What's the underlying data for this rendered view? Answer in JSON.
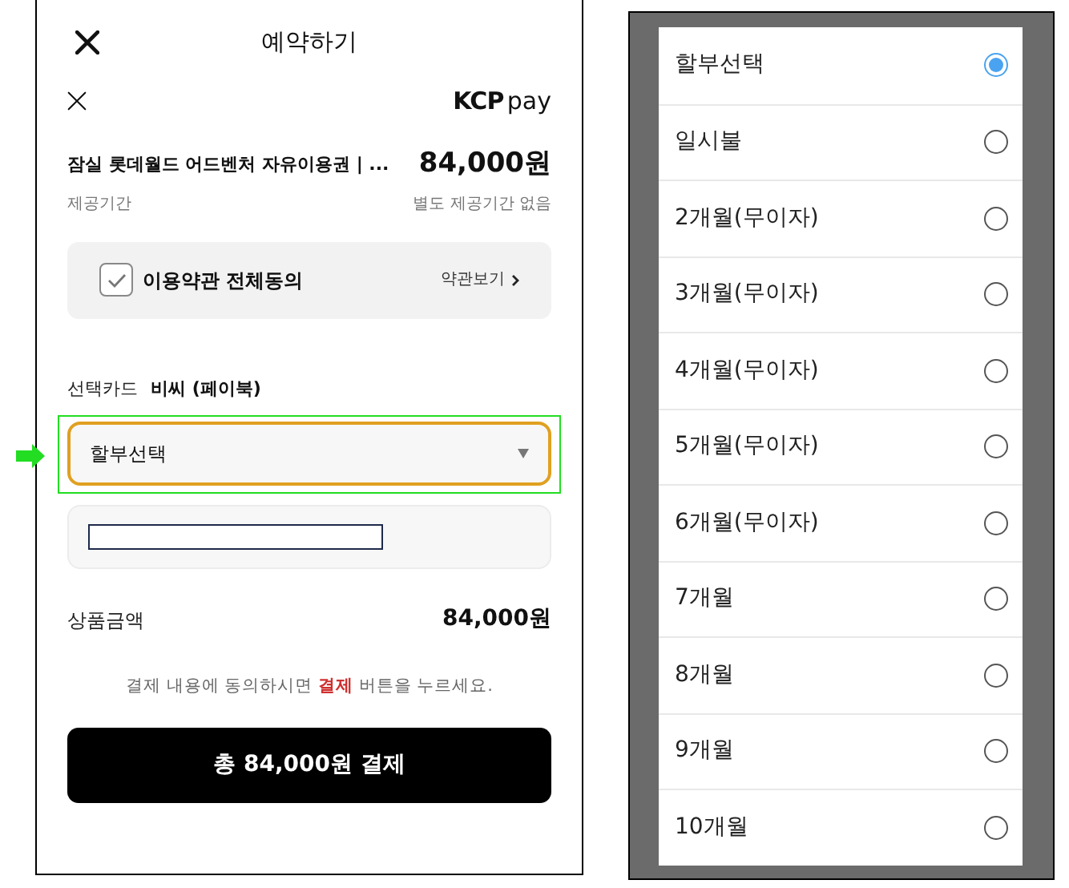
{
  "payment_screen": {
    "title": "예약하기",
    "brand": {
      "first": "KCP",
      "second": "pay"
    },
    "product": {
      "name": "잠실 롯데월드 어드벤처 자유이용권 | ...",
      "price": "84,000원",
      "period_label": "제공기간",
      "period_value": "별도 제공기간 없음"
    },
    "terms": {
      "label": "이용약관 전체동의",
      "checked": true,
      "link": "약관보기"
    },
    "card": {
      "label": "선택카드",
      "name": "비씨 (페이북)"
    },
    "installment_select": {
      "value": "할부선택",
      "highlighted": true
    },
    "amount": {
      "label": "상품금액",
      "value": "84,000원"
    },
    "notice": {
      "before": "결제 내용에 동의하시면 ",
      "highlight": "결제",
      "after": " 버튼을 누르세요."
    },
    "pay_button": "총 84,000원 결제"
  },
  "installment_options": [
    {
      "label": "할부선택",
      "selected": true
    },
    {
      "label": "일시불",
      "selected": false
    },
    {
      "label": "2개월(무이자)",
      "selected": false
    },
    {
      "label": "3개월(무이자)",
      "selected": false
    },
    {
      "label": "4개월(무이자)",
      "selected": false
    },
    {
      "label": "5개월(무이자)",
      "selected": false
    },
    {
      "label": "6개월(무이자)",
      "selected": false
    },
    {
      "label": "7개월",
      "selected": false
    },
    {
      "label": "8개월",
      "selected": false
    },
    {
      "label": "9개월",
      "selected": false
    },
    {
      "label": "10개월",
      "selected": false
    }
  ]
}
